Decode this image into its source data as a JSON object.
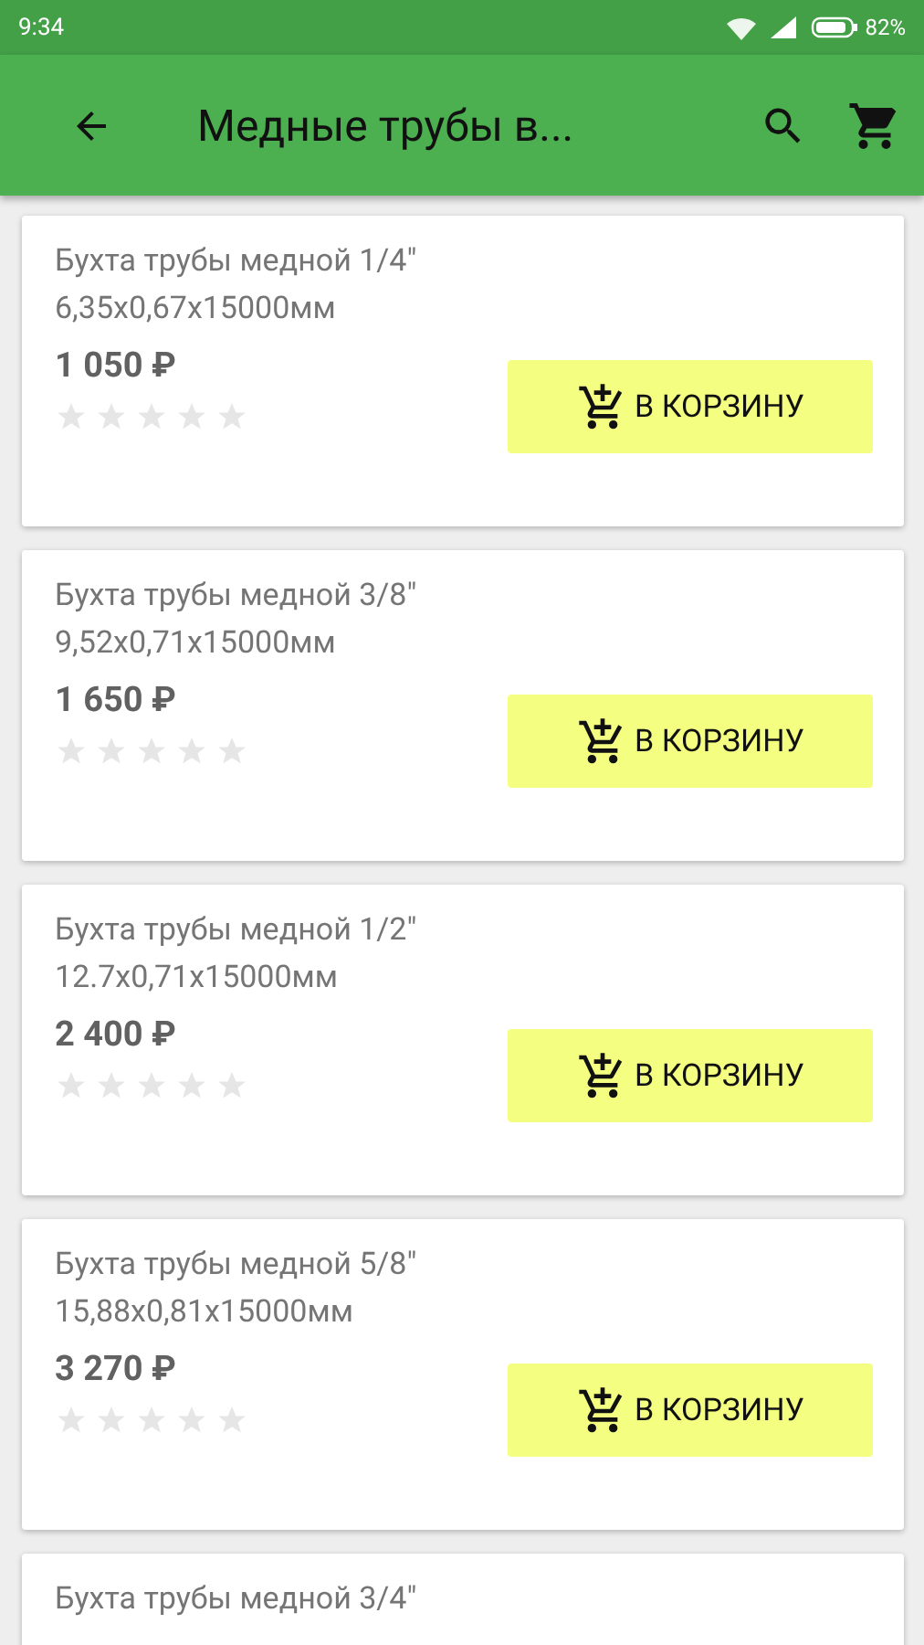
{
  "status_bar": {
    "time": "9:34",
    "battery": "82%"
  },
  "app_bar": {
    "title": "Медные трубы в..."
  },
  "products": [
    {
      "name": "Бухта трубы медной 1/4\"",
      "size": "6,35x0,67x15000мм",
      "price": "1 050 ₽",
      "stars": 0,
      "button": "В КОРЗИНУ"
    },
    {
      "name": "Бухта трубы медной 3/8\"",
      "size": "9,52x0,71x15000мм",
      "price": "1 650 ₽",
      "stars": 0,
      "button": "В КОРЗИНУ"
    },
    {
      "name": "Бухта трубы медной 1/2\"",
      "size": "12.7x0,71x15000мм",
      "price": "2 400 ₽",
      "stars": 0,
      "button": "В КОРЗИНУ"
    },
    {
      "name": "Бухта трубы медной 5/8\"",
      "size": "15,88x0,81x15000мм",
      "price": "3 270 ₽",
      "stars": 0,
      "button": "В КОРЗИНУ"
    },
    {
      "name": "Бухта трубы медной 3/4\""
    }
  ]
}
